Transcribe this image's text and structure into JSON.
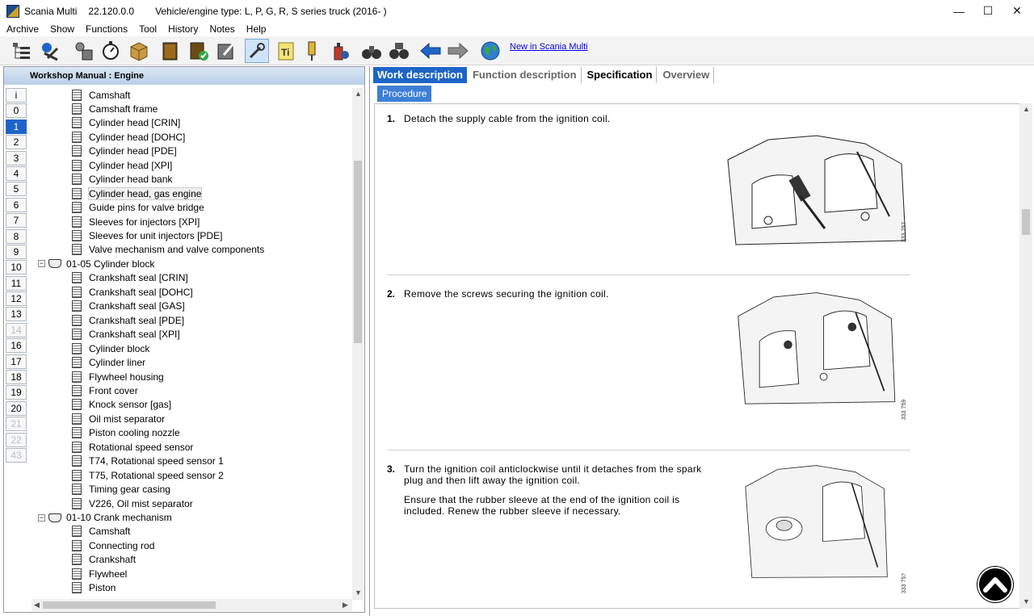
{
  "window": {
    "app_name": "Scania Multi",
    "version": "22.120.0.0",
    "vehicle": "Vehicle/engine type: L, P, G, R, S series truck (2016- )",
    "minimize": "—",
    "maximize": "☐",
    "close": "✕"
  },
  "menu": [
    "Archive",
    "Show",
    "Functions",
    "Tool",
    "History",
    "Notes",
    "Help"
  ],
  "toolbar": {
    "link": "New in Scania Multi"
  },
  "left": {
    "header": "Workshop Manual : Engine",
    "numbers": [
      "i",
      "0",
      "1",
      "2",
      "3",
      "4",
      "5",
      "6",
      "7",
      "8",
      "9",
      "10",
      "11",
      "12",
      "13",
      "14",
      "16",
      "17",
      "18",
      "19",
      "20",
      "21",
      "22",
      "43"
    ],
    "selected_number": "1",
    "disabled_numbers": [
      "14",
      "21",
      "22",
      "43"
    ],
    "tree": [
      {
        "label": "Camshaft",
        "type": "doc"
      },
      {
        "label": "Camshaft frame",
        "type": "doc"
      },
      {
        "label": "Cylinder head [CRIN]",
        "type": "doc"
      },
      {
        "label": "Cylinder head [DOHC]",
        "type": "doc"
      },
      {
        "label": "Cylinder head [PDE]",
        "type": "doc"
      },
      {
        "label": "Cylinder head [XPI]",
        "type": "doc"
      },
      {
        "label": "Cylinder head bank",
        "type": "doc"
      },
      {
        "label": "Cylinder head, gas engine",
        "type": "doc",
        "selected": true
      },
      {
        "label": "Guide pins for valve bridge",
        "type": "doc"
      },
      {
        "label": "Sleeves for injectors [XPI]",
        "type": "doc"
      },
      {
        "label": "Sleeves for unit injectors [PDE]",
        "type": "doc"
      },
      {
        "label": "Valve mechanism and valve components",
        "type": "doc"
      },
      {
        "label": "01-05 Cylinder block",
        "type": "group"
      },
      {
        "label": "Crankshaft seal [CRIN]",
        "type": "doc"
      },
      {
        "label": "Crankshaft seal [DOHC]",
        "type": "doc"
      },
      {
        "label": "Crankshaft seal [GAS]",
        "type": "doc"
      },
      {
        "label": "Crankshaft seal [PDE]",
        "type": "doc"
      },
      {
        "label": "Crankshaft seal [XPI]",
        "type": "doc"
      },
      {
        "label": "Cylinder block",
        "type": "doc"
      },
      {
        "label": "Cylinder liner",
        "type": "doc"
      },
      {
        "label": "Flywheel housing",
        "type": "doc"
      },
      {
        "label": "Front cover",
        "type": "doc"
      },
      {
        "label": "Knock sensor [gas]",
        "type": "doc"
      },
      {
        "label": "Oil mist separator",
        "type": "doc"
      },
      {
        "label": "Piston cooling nozzle",
        "type": "doc"
      },
      {
        "label": "Rotational speed sensor",
        "type": "doc"
      },
      {
        "label": "T74, Rotational speed sensor 1",
        "type": "doc"
      },
      {
        "label": "T75, Rotational speed sensor 2",
        "type": "doc"
      },
      {
        "label": "Timing gear casing",
        "type": "doc"
      },
      {
        "label": "V226, Oil mist separator",
        "type": "doc"
      },
      {
        "label": "01-10 Crank mechanism",
        "type": "group"
      },
      {
        "label": "Camshaft",
        "type": "doc"
      },
      {
        "label": "Connecting rod",
        "type": "doc"
      },
      {
        "label": "Crankshaft",
        "type": "doc"
      },
      {
        "label": "Flywheel",
        "type": "doc"
      },
      {
        "label": "Piston",
        "type": "doc"
      }
    ]
  },
  "right": {
    "tabs": [
      "Work description",
      "Function description",
      "Specification",
      "Overview"
    ],
    "active_tab": "Work description",
    "subtab": "Procedure",
    "steps": [
      {
        "num": "1.",
        "text": "Detach the supply cable from the ignition coil.",
        "image_id": "333 757"
      },
      {
        "num": "2.",
        "text": "Remove the screws securing the ignition coil.",
        "image_id": "333 759"
      },
      {
        "num": "3.",
        "text": "Turn the ignition coil anticlockwise until it detaches from the spark plug and then lift away the ignition coil.",
        "note": "Ensure that the rubber sleeve at the end of the ignition coil is included. Renew the rubber sleeve if necessary.",
        "image_id": "333 757"
      }
    ]
  },
  "colors": {
    "accent": "#1e64c8",
    "subtab": "#3d7fd6"
  }
}
